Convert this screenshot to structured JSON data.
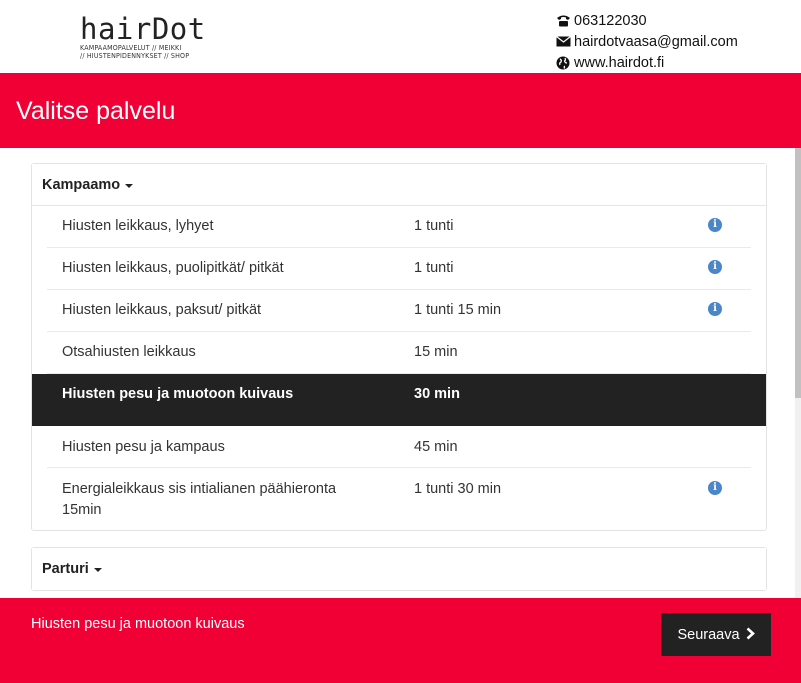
{
  "header": {
    "logo_word": "hairDot",
    "logo_tagline_1": "KAMPAAMOPALVELUT // MEIKKI",
    "logo_tagline_2": "// HIUSTENPIDENNYKSET // SHOP",
    "phone": "063122030",
    "email": "hairdotvaasa@gmail.com",
    "website": "www.hairdot.fi"
  },
  "banner": {
    "title": "Valitse palvelu"
  },
  "categories": [
    {
      "label": "Kampaamo",
      "services": [
        {
          "name": "Hiusten leikkaus, lyhyet",
          "duration": "1 tunti",
          "info": true
        },
        {
          "name": "Hiusten leikkaus, puolipitkät/ pitkät",
          "duration": "1 tunti",
          "info": true
        },
        {
          "name": "Hiusten leikkaus, paksut/ pitkät",
          "duration": "1 tunti 15 min",
          "info": true
        },
        {
          "name": "Otsahiusten leikkaus",
          "duration": "15 min",
          "info": false
        },
        {
          "name": "Hiusten pesu ja muotoon kuivaus",
          "duration": "30 min",
          "info": false,
          "selected": true
        },
        {
          "name": "Hiusten pesu ja kampaus",
          "duration": "45 min",
          "info": false
        },
        {
          "name": "Energialeikkaus sis intialianen päähieronta 15min",
          "duration": "1 tunti 30 min",
          "info": true
        }
      ]
    },
    {
      "label": "Parturi"
    }
  ],
  "footer": {
    "selected_service": "Hiusten pesu ja muotoon kuivaus",
    "next_label": "Seuraava"
  },
  "icons": {
    "phone": "phone-icon",
    "email": "envelope-icon",
    "website": "globe-icon",
    "info": "info-icon",
    "next": "chevron-right-icon"
  },
  "colors": {
    "brand_red": "#f00035",
    "selected_row": "#222222",
    "info_blue": "#4a86c8"
  }
}
